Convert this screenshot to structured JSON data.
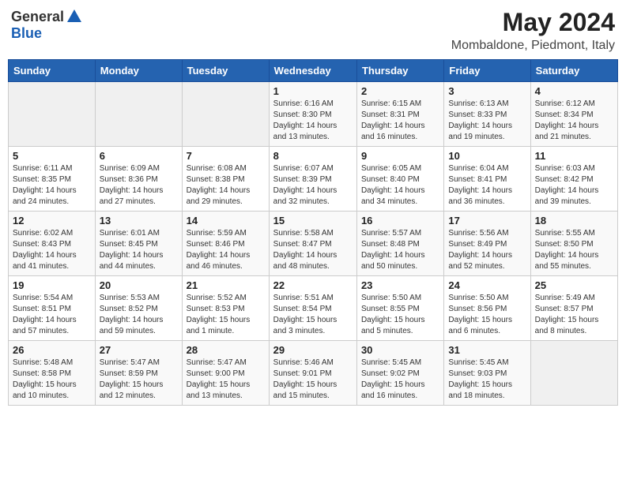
{
  "logo": {
    "general": "General",
    "blue": "Blue"
  },
  "title": {
    "month_year": "May 2024",
    "location": "Mombaldone, Piedmont, Italy"
  },
  "headers": [
    "Sunday",
    "Monday",
    "Tuesday",
    "Wednesday",
    "Thursday",
    "Friday",
    "Saturday"
  ],
  "weeks": [
    [
      {
        "day": "",
        "info": ""
      },
      {
        "day": "",
        "info": ""
      },
      {
        "day": "",
        "info": ""
      },
      {
        "day": "1",
        "info": "Sunrise: 6:16 AM\nSunset: 8:30 PM\nDaylight: 14 hours\nand 13 minutes."
      },
      {
        "day": "2",
        "info": "Sunrise: 6:15 AM\nSunset: 8:31 PM\nDaylight: 14 hours\nand 16 minutes."
      },
      {
        "day": "3",
        "info": "Sunrise: 6:13 AM\nSunset: 8:33 PM\nDaylight: 14 hours\nand 19 minutes."
      },
      {
        "day": "4",
        "info": "Sunrise: 6:12 AM\nSunset: 8:34 PM\nDaylight: 14 hours\nand 21 minutes."
      }
    ],
    [
      {
        "day": "5",
        "info": "Sunrise: 6:11 AM\nSunset: 8:35 PM\nDaylight: 14 hours\nand 24 minutes."
      },
      {
        "day": "6",
        "info": "Sunrise: 6:09 AM\nSunset: 8:36 PM\nDaylight: 14 hours\nand 27 minutes."
      },
      {
        "day": "7",
        "info": "Sunrise: 6:08 AM\nSunset: 8:38 PM\nDaylight: 14 hours\nand 29 minutes."
      },
      {
        "day": "8",
        "info": "Sunrise: 6:07 AM\nSunset: 8:39 PM\nDaylight: 14 hours\nand 32 minutes."
      },
      {
        "day": "9",
        "info": "Sunrise: 6:05 AM\nSunset: 8:40 PM\nDaylight: 14 hours\nand 34 minutes."
      },
      {
        "day": "10",
        "info": "Sunrise: 6:04 AM\nSunset: 8:41 PM\nDaylight: 14 hours\nand 36 minutes."
      },
      {
        "day": "11",
        "info": "Sunrise: 6:03 AM\nSunset: 8:42 PM\nDaylight: 14 hours\nand 39 minutes."
      }
    ],
    [
      {
        "day": "12",
        "info": "Sunrise: 6:02 AM\nSunset: 8:43 PM\nDaylight: 14 hours\nand 41 minutes."
      },
      {
        "day": "13",
        "info": "Sunrise: 6:01 AM\nSunset: 8:45 PM\nDaylight: 14 hours\nand 44 minutes."
      },
      {
        "day": "14",
        "info": "Sunrise: 5:59 AM\nSunset: 8:46 PM\nDaylight: 14 hours\nand 46 minutes."
      },
      {
        "day": "15",
        "info": "Sunrise: 5:58 AM\nSunset: 8:47 PM\nDaylight: 14 hours\nand 48 minutes."
      },
      {
        "day": "16",
        "info": "Sunrise: 5:57 AM\nSunset: 8:48 PM\nDaylight: 14 hours\nand 50 minutes."
      },
      {
        "day": "17",
        "info": "Sunrise: 5:56 AM\nSunset: 8:49 PM\nDaylight: 14 hours\nand 52 minutes."
      },
      {
        "day": "18",
        "info": "Sunrise: 5:55 AM\nSunset: 8:50 PM\nDaylight: 14 hours\nand 55 minutes."
      }
    ],
    [
      {
        "day": "19",
        "info": "Sunrise: 5:54 AM\nSunset: 8:51 PM\nDaylight: 14 hours\nand 57 minutes."
      },
      {
        "day": "20",
        "info": "Sunrise: 5:53 AM\nSunset: 8:52 PM\nDaylight: 14 hours\nand 59 minutes."
      },
      {
        "day": "21",
        "info": "Sunrise: 5:52 AM\nSunset: 8:53 PM\nDaylight: 15 hours\nand 1 minute."
      },
      {
        "day": "22",
        "info": "Sunrise: 5:51 AM\nSunset: 8:54 PM\nDaylight: 15 hours\nand 3 minutes."
      },
      {
        "day": "23",
        "info": "Sunrise: 5:50 AM\nSunset: 8:55 PM\nDaylight: 15 hours\nand 5 minutes."
      },
      {
        "day": "24",
        "info": "Sunrise: 5:50 AM\nSunset: 8:56 PM\nDaylight: 15 hours\nand 6 minutes."
      },
      {
        "day": "25",
        "info": "Sunrise: 5:49 AM\nSunset: 8:57 PM\nDaylight: 15 hours\nand 8 minutes."
      }
    ],
    [
      {
        "day": "26",
        "info": "Sunrise: 5:48 AM\nSunset: 8:58 PM\nDaylight: 15 hours\nand 10 minutes."
      },
      {
        "day": "27",
        "info": "Sunrise: 5:47 AM\nSunset: 8:59 PM\nDaylight: 15 hours\nand 12 minutes."
      },
      {
        "day": "28",
        "info": "Sunrise: 5:47 AM\nSunset: 9:00 PM\nDaylight: 15 hours\nand 13 minutes."
      },
      {
        "day": "29",
        "info": "Sunrise: 5:46 AM\nSunset: 9:01 PM\nDaylight: 15 hours\nand 15 minutes."
      },
      {
        "day": "30",
        "info": "Sunrise: 5:45 AM\nSunset: 9:02 PM\nDaylight: 15 hours\nand 16 minutes."
      },
      {
        "day": "31",
        "info": "Sunrise: 5:45 AM\nSunset: 9:03 PM\nDaylight: 15 hours\nand 18 minutes."
      },
      {
        "day": "",
        "info": ""
      }
    ]
  ]
}
